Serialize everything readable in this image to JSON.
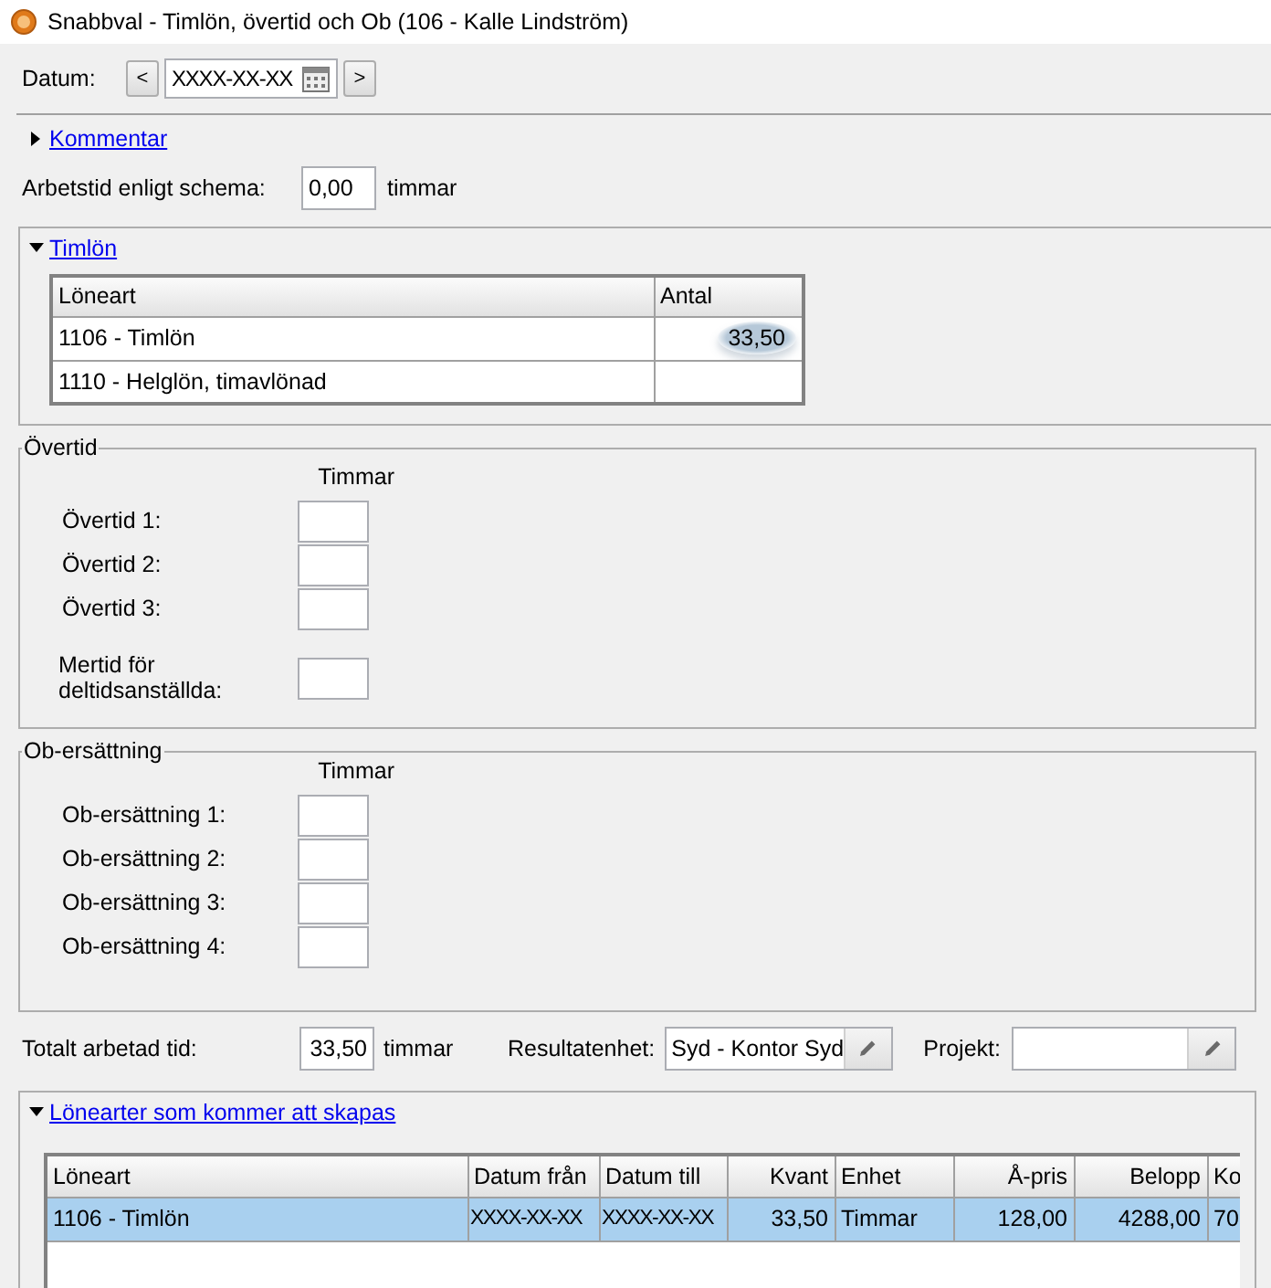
{
  "window": {
    "title": "Snabbval - Timlön, övertid och Ob (106 - Kalle Lindström)"
  },
  "date": {
    "label": "Datum:",
    "prev": "<",
    "value": "XXXX-XX-XX",
    "next": ">"
  },
  "comment": {
    "label": "Kommentar",
    "expanded": false
  },
  "schedule": {
    "label": "Arbetstid enligt schema:",
    "value": "0,00",
    "unit": "timmar"
  },
  "hourly": {
    "title": "Timlön",
    "expanded": true,
    "columns": [
      "Löneart",
      "Antal"
    ],
    "rows": [
      {
        "type": "1106 - Timlön",
        "amount": "33,50",
        "highlighted": true
      },
      {
        "type": "1110 - Helglön, timavlönad",
        "highlighted": false
      }
    ]
  },
  "overtime": {
    "title": "Övertid",
    "column": "Timmar",
    "fields": [
      {
        "kind": "single",
        "label": "Övertid 1:"
      },
      {
        "kind": "single",
        "label": "Övertid 2:"
      },
      {
        "kind": "single",
        "label": "Övertid 3:"
      },
      {
        "kind": "wrapped",
        "label": "Mertid för deltidsanställda:"
      }
    ]
  },
  "ob": {
    "title": "Ob-ersättning",
    "column": "Timmar",
    "fields": [
      {
        "kind": "single",
        "label": "Ob-ersättning 1:"
      },
      {
        "kind": "single",
        "label": "Ob-ersättning 2:"
      },
      {
        "kind": "single",
        "label": "Ob-ersättning 3:"
      },
      {
        "kind": "single",
        "label": "Ob-ersättning 4:"
      }
    ]
  },
  "totals": {
    "label": "Totalt arbetad tid:",
    "value": "33,50",
    "unit": "timmar",
    "result_unit": {
      "label": "Resultatenhet:",
      "value": "Syd - Kontor Syd"
    },
    "project": {
      "label": "Projekt:"
    }
  },
  "generated": {
    "title": "Lönearter som kommer att skapas",
    "expanded": true,
    "columns": [
      "Löneart",
      "Datum från",
      "Datum till",
      "Kvant",
      "Enhet",
      "Å-pris",
      "Belopp",
      "Ko"
    ],
    "rows": [
      {
        "cells": [
          "1106 - Timlön",
          "XXXX-XX-XX",
          "XXXX-XX-XX",
          "33,50",
          "Timmar",
          "128,00",
          "4288,00",
          "70"
        ],
        "selected": true
      }
    ]
  }
}
